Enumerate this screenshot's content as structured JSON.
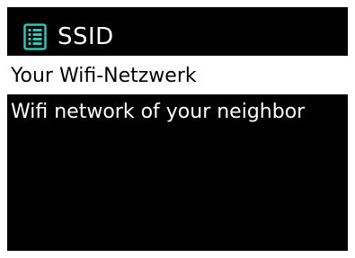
{
  "header": {
    "title": "SSID",
    "icon": "list-icon"
  },
  "network_list": {
    "items": [
      {
        "label": "Your Wifi-Netzwerk",
        "selected": true
      },
      {
        "label": "Wifi network of your neighbor",
        "selected": false
      }
    ]
  },
  "colors": {
    "background": "#000000",
    "foreground": "#ffffff",
    "accent": "#2ec4b6",
    "selected_bg": "#ffffff",
    "selected_fg": "#000000"
  }
}
